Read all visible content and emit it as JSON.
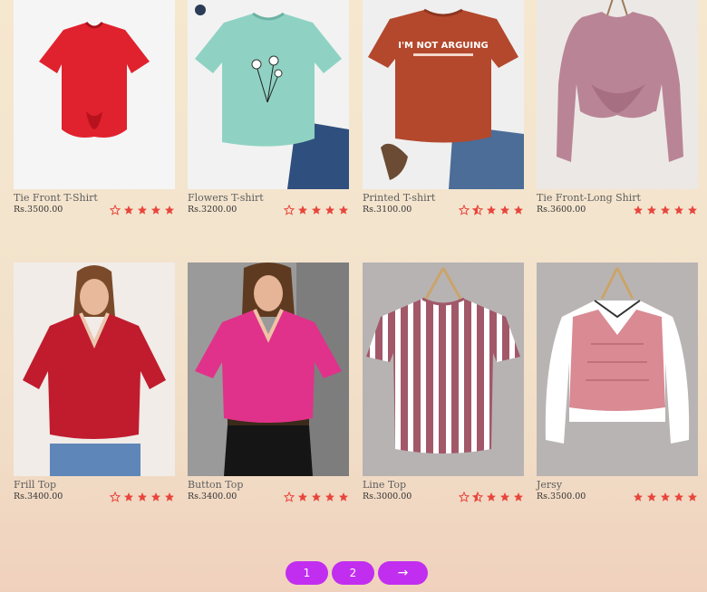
{
  "products": [
    {
      "name": "Tie Front T-Shirt",
      "price": "Rs.3500.00",
      "rating": "4.5"
    },
    {
      "name": "Flowers T-shirt",
      "price": "Rs.3200.00",
      "rating": "4.5"
    },
    {
      "name": "Printed T-shirt",
      "price": "Rs.3100.00",
      "rating": "3.5",
      "shirt_text": "I'M NOT ARGUING"
    },
    {
      "name": "Tie Front-Long Shirt",
      "price": "Rs.3600.00",
      "rating": "5"
    },
    {
      "name": "Frill Top",
      "price": "Rs.3400.00",
      "rating": "4.5"
    },
    {
      "name": "Button Top",
      "price": "Rs.3400.00",
      "rating": "4.5"
    },
    {
      "name": "Line Top",
      "price": "Rs.3000.00",
      "rating": "3.5"
    },
    {
      "name": "Jersy",
      "price": "Rs.3500.00",
      "rating": "5"
    }
  ],
  "pagination": {
    "page1": "1",
    "page2": "2",
    "next": "→"
  },
  "colors": {
    "accent": "#c12ef0",
    "star": "#e8453c"
  }
}
